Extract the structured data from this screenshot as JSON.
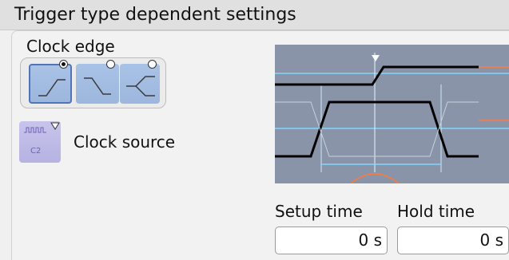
{
  "title": "Trigger type dependent settings",
  "clock_edge": {
    "label": "Clock edge",
    "options": [
      {
        "name": "rising-edge",
        "selected": true
      },
      {
        "name": "falling-edge",
        "selected": false
      },
      {
        "name": "both-edges",
        "selected": false
      }
    ]
  },
  "clock_source": {
    "label": "Clock source",
    "icon": "clock-source-icon"
  },
  "setup_time": {
    "label": "Setup time",
    "value": "0 s"
  },
  "hold_time": {
    "label": "Hold time",
    "value": "0 s"
  },
  "colors": {
    "trace": "#000000",
    "cursor": "#7fd7ff",
    "button": "#a9c2e6",
    "source_button": "#c7c4ec",
    "waveform_bg": "#8a94a9"
  }
}
